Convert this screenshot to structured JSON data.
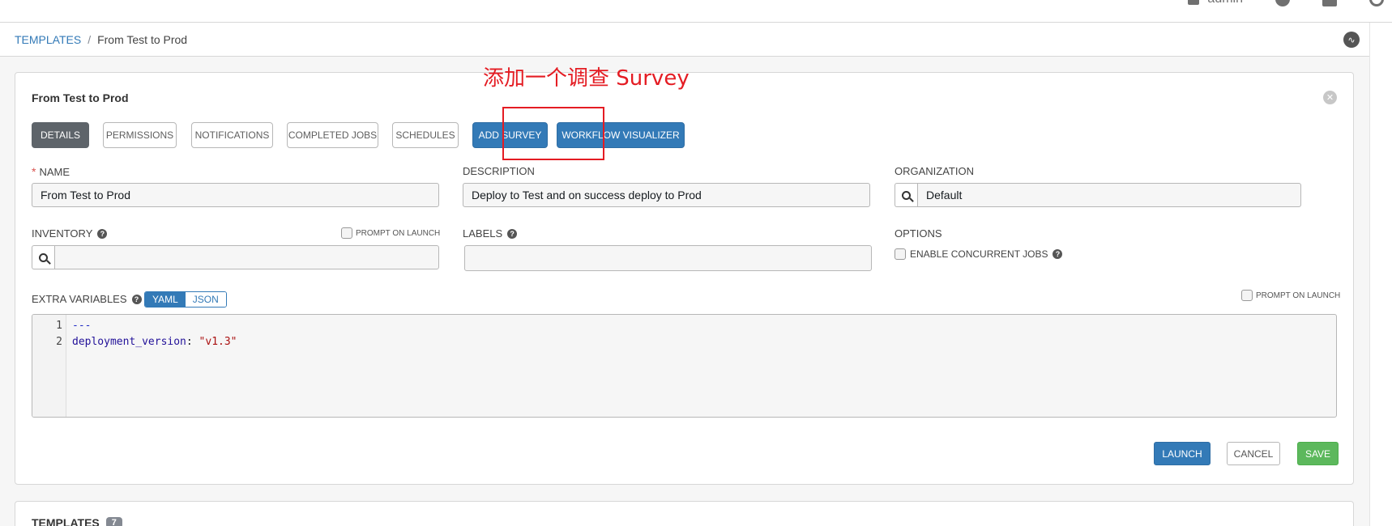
{
  "topbar": {
    "user_label": "admin",
    "icons": [
      "user-icon",
      "info-icon",
      "book-icon",
      "power-icon"
    ]
  },
  "breadcrumb": {
    "parent": "TEMPLATES",
    "separator": "/",
    "current": "From Test to Prod",
    "activity_icon": "activity-stream-icon"
  },
  "form": {
    "title": "From Test to Prod",
    "tabs": [
      {
        "label": "DETAILS",
        "active": true
      },
      {
        "label": "PERMISSIONS"
      },
      {
        "label": "NOTIFICATIONS"
      },
      {
        "label": "COMPLETED JOBS"
      },
      {
        "label": "SCHEDULES"
      },
      {
        "label": "ADD SURVEY",
        "primary": true
      },
      {
        "label": "WORKFLOW VISUALIZER",
        "primary": true
      }
    ],
    "name": {
      "required_mark": "*",
      "label": "NAME",
      "value": "From Test to Prod"
    },
    "description": {
      "label": "DESCRIPTION",
      "value": "Deploy to Test and on success deploy to Prod"
    },
    "organization": {
      "label": "ORGANIZATION",
      "value": "Default"
    },
    "inventory": {
      "label": "INVENTORY",
      "value": "",
      "prompt_on_launch": "PROMPT ON LAUNCH"
    },
    "labels": {
      "label": "LABELS",
      "value": ""
    },
    "options": {
      "label": "OPTIONS",
      "concurrent": "ENABLE CONCURRENT JOBS"
    },
    "extra_vars": {
      "label": "EXTRA VARIABLES",
      "modes": [
        "YAML",
        "JSON"
      ],
      "active_mode": "YAML",
      "prompt_on_launch": "PROMPT ON LAUNCH",
      "line_numbers": [
        "1",
        "2"
      ],
      "line1": "---",
      "line2_key": "deployment_version",
      "line2_colon": ": ",
      "line2_value": "\"v1.3\""
    },
    "actions": {
      "launch": "LAUNCH",
      "cancel": "CANCEL",
      "save": "SAVE"
    },
    "help_glyph": "?"
  },
  "annotation": {
    "text": "添加一个调查 Survey",
    "color": "#e41c23"
  },
  "templates_panel": {
    "title": "TEMPLATES",
    "count": "7"
  },
  "colors": {
    "primary": "#337ab7",
    "success": "#5cb85c",
    "active_tab": "#5e646a",
    "required": "#d9534f"
  }
}
